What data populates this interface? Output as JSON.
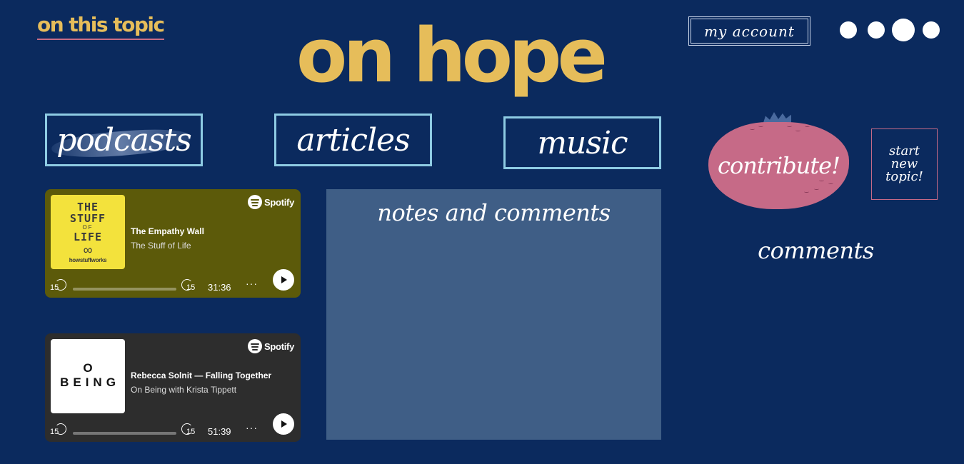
{
  "header": {
    "topic_link": "on this topic",
    "title": "on hope",
    "account_label": "my account"
  },
  "nav_dots": [
    "dot-1",
    "dot-2",
    "dot-3",
    "dot-4"
  ],
  "categories": [
    {
      "label": "podcasts"
    },
    {
      "label": "articles"
    },
    {
      "label": "music"
    }
  ],
  "podcasts": [
    {
      "brand": "Spotify",
      "title": "The Empathy Wall",
      "show": "The Stuff of Life",
      "cover_text": [
        "THE",
        "STUFF",
        "OF",
        "LIFE",
        "∞",
        "howstuffworks"
      ],
      "skip_back": "15",
      "skip_forward": "15",
      "duration": "31:36",
      "more": "···",
      "background": "#5c5a0a"
    },
    {
      "brand": "Spotify",
      "title": "Rebecca Solnit — Falling Together",
      "show": "On Being with Krista Tippett",
      "cover_text": [
        "O",
        "BEING"
      ],
      "skip_back": "15",
      "skip_forward": "15",
      "duration": "51:39",
      "more": "···",
      "background": "#2d2d2d"
    }
  ],
  "notes": {
    "title": "notes and comments"
  },
  "sidebar": {
    "contribute_label": "contribute!",
    "start_topic_lines": [
      "start",
      "new",
      "topic!"
    ],
    "comments_label": "comments"
  },
  "colors": {
    "background": "#0b2a5e",
    "accent_gold": "#e6bd5a",
    "accent_pink": "#c66a87",
    "tab_border": "#8ecbe3",
    "notes_panel": "#3f5e86"
  }
}
